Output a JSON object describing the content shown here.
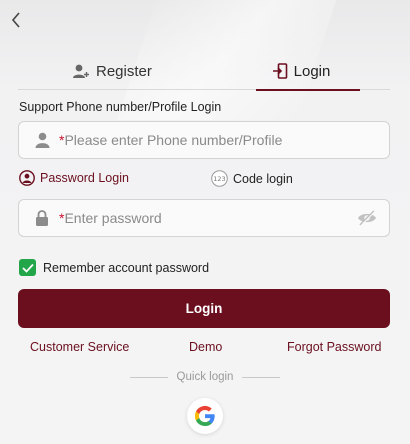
{
  "nav": {
    "back_icon": "chevron-left-icon"
  },
  "tabs": [
    {
      "label": "Register",
      "icon": "add-user-icon"
    },
    {
      "label": "Login",
      "icon": "login-door-icon"
    }
  ],
  "form": {
    "support_label": "Support Phone number/Profile Login",
    "phone": {
      "required_mark": "*",
      "placeholder": "Please enter Phone number/Profile",
      "value": "",
      "icon": "user-icon"
    },
    "login_modes": [
      {
        "label": "Password Login",
        "icon": "user-circle-icon",
        "active": true
      },
      {
        "label": "Code login",
        "icon": "code-123-icon",
        "active": false
      }
    ],
    "password": {
      "required_mark": "*",
      "placeholder": "Enter password",
      "value": "",
      "icon": "lock-icon",
      "toggle_icon": "eye-off-icon"
    },
    "remember_label": "Remember account password",
    "remember_checked": true,
    "submit_label": "Login"
  },
  "links": {
    "customer_service": "Customer Service",
    "demo": "Demo",
    "forgot_password": "Forgot Password"
  },
  "quick_login": {
    "label": "Quick login",
    "providers": [
      "google-icon"
    ]
  },
  "colors": {
    "accent": "#6b0f1f",
    "check": "#23a64a",
    "required": "#c8102e"
  }
}
